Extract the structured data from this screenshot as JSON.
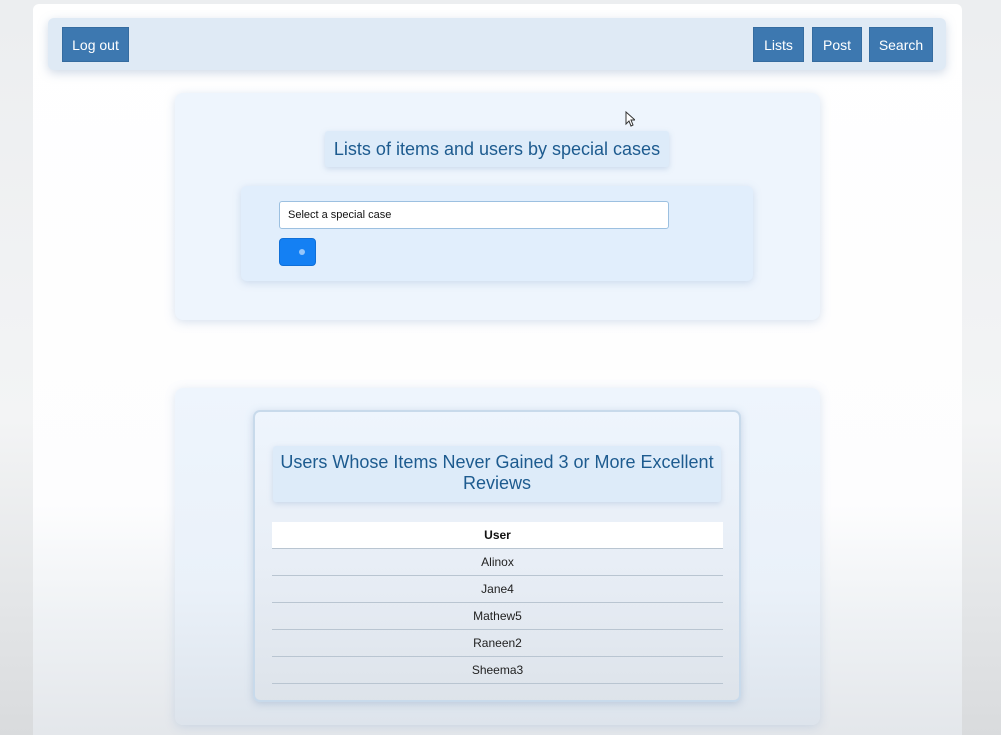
{
  "navbar": {
    "logout_label": "Log out",
    "lists_label": "Lists",
    "post_label": "Post",
    "search_label": "Search"
  },
  "special_cases": {
    "heading": "Lists of items and users by special cases",
    "select_value": "Select a special case"
  },
  "results": {
    "heading": "Users Whose Items Never Gained 3 or More Excellent Reviews",
    "column_header": "User",
    "rows": [
      "Alinox",
      "Jane4",
      "Mathew5",
      "Raneen2",
      "Sheema3"
    ]
  },
  "colors": {
    "nav_button": "#3d78b0",
    "heading_text": "#1d5b8f",
    "submit_button": "#1480f3"
  },
  "icons": {
    "cursor": "mouse-pointer-icon"
  }
}
